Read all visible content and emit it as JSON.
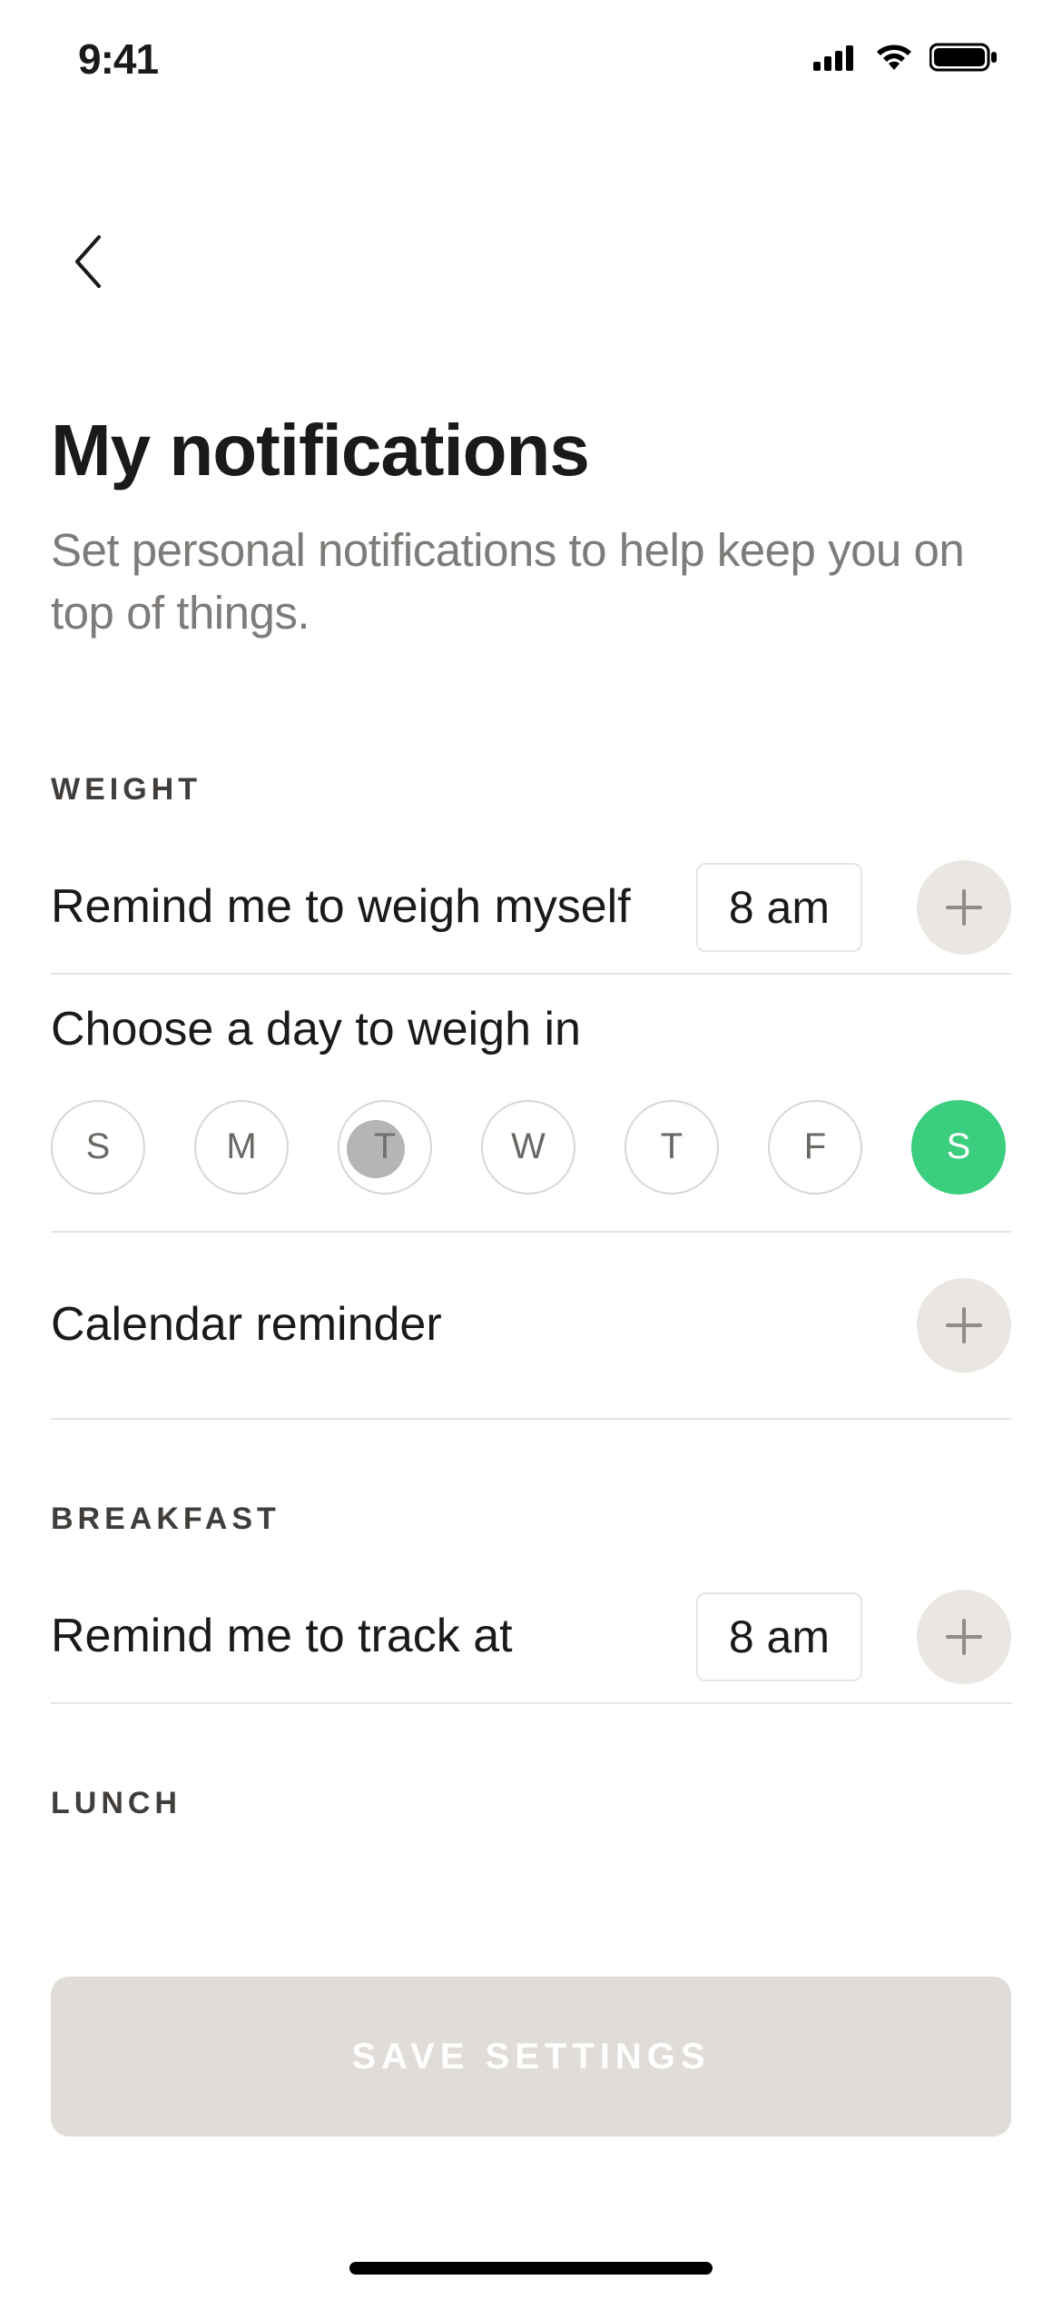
{
  "status": {
    "time": "9:41"
  },
  "header": {
    "title": "My notifications",
    "subtitle": "Set personal notifications to help keep you on top of things."
  },
  "sections": {
    "weight": {
      "header": "WEIGHT",
      "remind_label": "Remind me to weigh myself",
      "remind_time": "8 am",
      "choose_day_label": "Choose a day to weigh in",
      "days": [
        {
          "abbr": "S",
          "selected": false
        },
        {
          "abbr": "M",
          "selected": false
        },
        {
          "abbr": "T",
          "selected": false
        },
        {
          "abbr": "W",
          "selected": false
        },
        {
          "abbr": "T",
          "selected": false
        },
        {
          "abbr": "F",
          "selected": false
        },
        {
          "abbr": "S",
          "selected": true
        }
      ],
      "calendar_label": "Calendar reminder"
    },
    "breakfast": {
      "header": "BREAKFAST",
      "remind_label": "Remind me to track at",
      "remind_time": "8 am"
    },
    "lunch": {
      "header": "LUNCH"
    }
  },
  "footer": {
    "save_label": "SAVE SETTINGS"
  }
}
